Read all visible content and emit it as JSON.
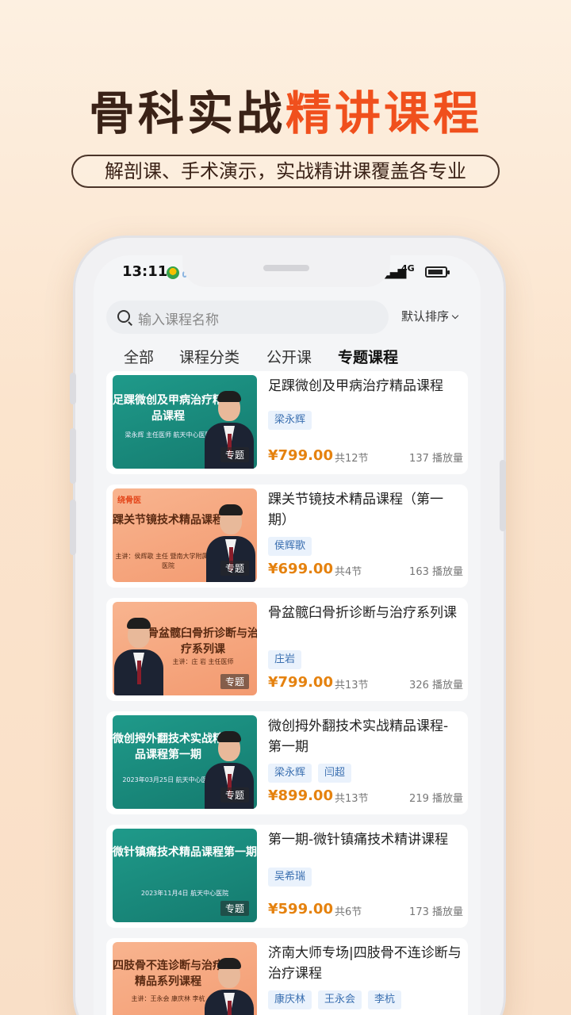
{
  "banner": {
    "title_main": "骨科实战",
    "title_accent": "精讲课程",
    "subtitle": "解剖课、手术演示，实战精讲课覆盖各专业"
  },
  "status_bar": {
    "time": "13:11",
    "network": "4G"
  },
  "search": {
    "placeholder": "输入课程名称",
    "sort_label": "默认排序"
  },
  "tabs": [
    {
      "label": "全部"
    },
    {
      "label": "课程分类"
    },
    {
      "label": "公开课"
    },
    {
      "label": "专题课程",
      "active": true
    }
  ],
  "courses": [
    {
      "title": "足踝微创及甲病治疗精品课程",
      "thumb_title": "足踝微创及甲病治疗精品课程",
      "thumb_sub": "梁永辉 主任医师 航天中心医院",
      "thumb_tag": "专题",
      "teachers": [
        "梁永辉"
      ],
      "price": "¥799.00",
      "lessons": "共12节",
      "plays": "137 播放量"
    },
    {
      "title": "踝关节镜技术精品课程（第一期）",
      "thumb_title": "踝关节镜技术精品课程",
      "thumb_sub": "主讲：侯辉歌 主任 暨南大学附属第一医院",
      "thumb_logo": "绕骨医",
      "thumb_tag": "专题",
      "teachers": [
        "侯辉歌"
      ],
      "price": "¥699.00",
      "lessons": "共4节",
      "plays": "163 播放量"
    },
    {
      "title": "骨盆髋臼骨折诊断与治疗系列课",
      "thumb_title": "骨盆髋臼骨折诊断与治疗系列课",
      "thumb_sub": "主讲：庄 岩 主任医师",
      "thumb_tag": "专题",
      "teachers": [
        "庄岩"
      ],
      "price": "¥799.00",
      "lessons": "共13节",
      "plays": "326 播放量"
    },
    {
      "title": "微创拇外翻技术实战精品课程-第一期",
      "thumb_title": "微创拇外翻技术实战精品课程第一期",
      "thumb_sub": "2023年03月25日 航天中心医院",
      "thumb_tag": "专题",
      "teachers": [
        "梁永辉",
        "闫超"
      ],
      "price": "¥899.00",
      "lessons": "共13节",
      "plays": "219 播放量"
    },
    {
      "title": "第一期-微针镇痛技术精讲课程",
      "thumb_title": "微针镇痛技术精品课程第一期",
      "thumb_sub": "2023年11月4日 航天中心医院",
      "thumb_tag": "专题",
      "teachers": [
        "吴希瑞"
      ],
      "price": "¥599.00",
      "lessons": "共6节",
      "plays": "173 播放量"
    },
    {
      "title": "济南大师专场|四肢骨不连诊断与治疗课程",
      "thumb_title": "四肢骨不连诊断与治疗精品系列课程",
      "thumb_sub": "主讲：王永会 康庆林 李杭",
      "teachers": [
        "康庆林",
        "王永会",
        "李杭"
      ]
    }
  ]
}
